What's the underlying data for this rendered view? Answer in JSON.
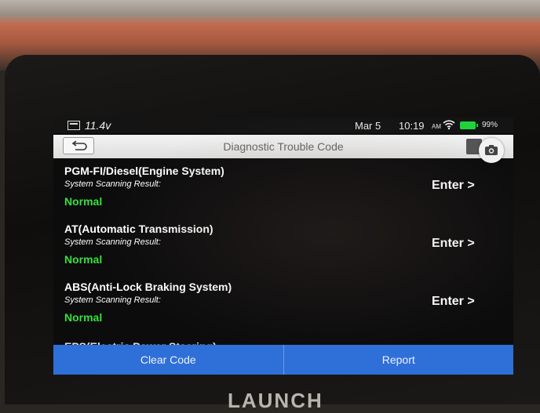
{
  "status_bar": {
    "voltage": "11.4v",
    "date": "Mar 5",
    "time": "10:19",
    "ampm": "AM",
    "battery_percent": "99%"
  },
  "header": {
    "title": "Diagnostic Trouble Code"
  },
  "systems": [
    {
      "name": "PGM-FI/Diesel(Engine System)",
      "result_label": "System Scanning Result:",
      "status": "Normal",
      "action": "Enter >"
    },
    {
      "name": "AT(Automatic Transmission)",
      "result_label": "System Scanning Result:",
      "status": "Normal",
      "action": "Enter >"
    },
    {
      "name": "ABS(Anti-Lock Braking System)",
      "result_label": "System Scanning Result:",
      "status": "Normal",
      "action": "Enter >"
    }
  ],
  "partial_item": "EPS(Electric Power Steering)",
  "bottom_bar": {
    "clear_label": "Clear Code",
    "report_label": "Report"
  },
  "device": {
    "brand": "LAUNCH"
  },
  "colors": {
    "accent_blue": "#2f6fd8",
    "normal_green": "#35e03a",
    "battery_green": "#1fd33a"
  },
  "icons": [
    "battery-status-icon",
    "wifi-icon",
    "battery-icon",
    "back-arrow-icon",
    "print-icon",
    "camera-icon"
  ]
}
